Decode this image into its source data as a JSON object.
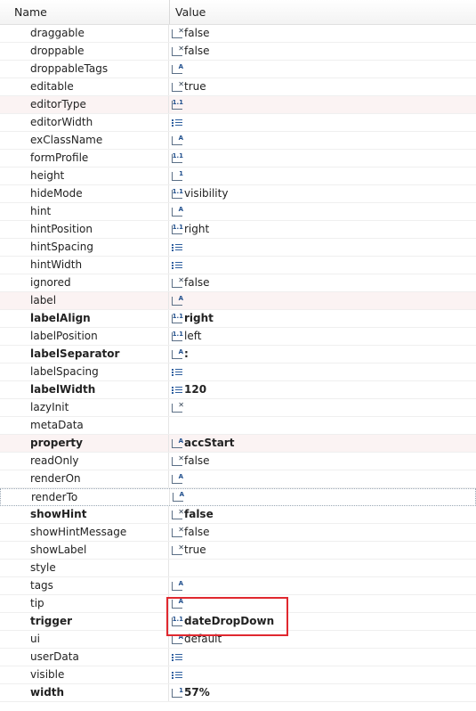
{
  "header": {
    "name_label": "Name",
    "value_label": "Value"
  },
  "rows": [
    {
      "name": "draggable",
      "value": "false",
      "icon": "bool-icon"
    },
    {
      "name": "droppable",
      "value": "false",
      "icon": "bool-icon"
    },
    {
      "name": "droppableTags",
      "value": "",
      "icon": "string-icon"
    },
    {
      "name": "editable",
      "value": "true",
      "icon": "bool-icon"
    },
    {
      "name": "editorType",
      "value": "",
      "icon": "enum-icon"
    },
    {
      "name": "editorWidth",
      "value": "",
      "icon": "list-icon"
    },
    {
      "name": "exClassName",
      "value": "",
      "icon": "string-icon"
    },
    {
      "name": "formProfile",
      "value": "",
      "icon": "enum-icon"
    },
    {
      "name": "height",
      "value": "",
      "icon": "number-icon"
    },
    {
      "name": "hideMode",
      "value": "visibility",
      "icon": "enum-icon"
    },
    {
      "name": "hint",
      "value": "",
      "icon": "string-icon"
    },
    {
      "name": "hintPosition",
      "value": "right",
      "icon": "enum-icon"
    },
    {
      "name": "hintSpacing",
      "value": "",
      "icon": "list-icon"
    },
    {
      "name": "hintWidth",
      "value": "",
      "icon": "list-icon"
    },
    {
      "name": "ignored",
      "value": "false",
      "icon": "bool-icon"
    },
    {
      "name": "label",
      "value": "",
      "icon": "string-icon"
    },
    {
      "name": "labelAlign",
      "value": "right",
      "icon": "enum-icon"
    },
    {
      "name": "labelPosition",
      "value": "left",
      "icon": "enum-icon"
    },
    {
      "name": "labelSeparator",
      "value": ":",
      "icon": "string-icon"
    },
    {
      "name": "labelSpacing",
      "value": "",
      "icon": "list-icon"
    },
    {
      "name": "labelWidth",
      "value": "120",
      "icon": "list-icon"
    },
    {
      "name": "lazyInit",
      "value": "",
      "icon": "bool-icon"
    },
    {
      "name": "metaData",
      "value": "",
      "icon": "none"
    },
    {
      "name": "property",
      "value": "accStart",
      "icon": "string-icon"
    },
    {
      "name": "readOnly",
      "value": "false",
      "icon": "bool-icon"
    },
    {
      "name": "renderOn",
      "value": "",
      "icon": "string-icon"
    },
    {
      "name": "renderTo",
      "value": "",
      "icon": "string-icon"
    },
    {
      "name": "showHint",
      "value": "false",
      "icon": "bool-icon"
    },
    {
      "name": "showHintMessage",
      "value": "false",
      "icon": "bool-icon"
    },
    {
      "name": "showLabel",
      "value": "true",
      "icon": "bool-icon"
    },
    {
      "name": "style",
      "value": "",
      "icon": "none"
    },
    {
      "name": "tags",
      "value": "",
      "icon": "string-icon"
    },
    {
      "name": "tip",
      "value": "",
      "icon": "string-icon"
    },
    {
      "name": "trigger",
      "value": "dateDropDown",
      "icon": "enum-icon"
    },
    {
      "name": "ui",
      "value": "default",
      "icon": "string-icon"
    },
    {
      "name": "userData",
      "value": "",
      "icon": "list-icon"
    },
    {
      "name": "visible",
      "value": "",
      "icon": "list-icon"
    },
    {
      "name": "width",
      "value": "57%",
      "icon": "number-icon"
    }
  ],
  "bold_rows": [
    "labelAlign",
    "labelSeparator",
    "labelWidth",
    "property",
    "showHint",
    "trigger",
    "width"
  ],
  "pink_rows": [
    "editorType",
    "label",
    "property"
  ],
  "focused_row": "renderTo",
  "highlighted_row": "trigger",
  "colors": {
    "highlight_border": "#e0282f",
    "icon_blue": "#1f4e8c",
    "pink_row": "#fbf3f3"
  }
}
